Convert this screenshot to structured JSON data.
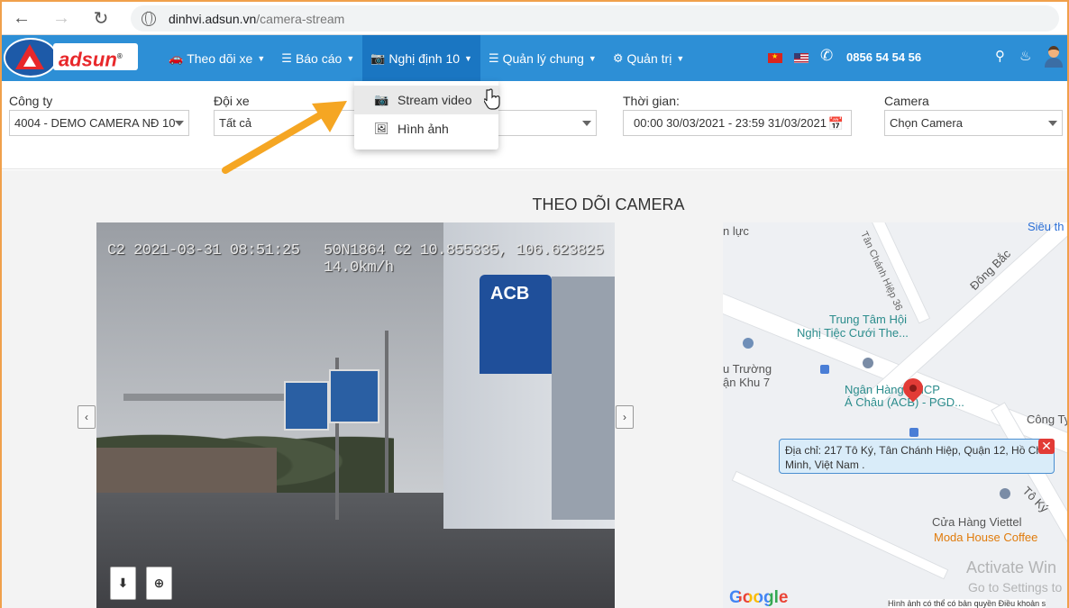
{
  "browser": {
    "url_host": "dinhvi.adsun.vn",
    "url_path": "/camera-stream"
  },
  "header": {
    "logo_text": "adsun",
    "menu": [
      {
        "label": "Theo dõi xe",
        "icon": "car-icon"
      },
      {
        "label": "Báo cáo",
        "icon": "list-icon"
      },
      {
        "label": "Nghị định 10",
        "icon": "camera-icon"
      },
      {
        "label": "Quản lý chung",
        "icon": "list-icon"
      },
      {
        "label": "Quản trị",
        "icon": "gears-icon"
      }
    ],
    "phone": "0856 54 54 56"
  },
  "dropdown": {
    "items": [
      {
        "label": "Stream video",
        "icon": "camera-icon"
      },
      {
        "label": "Hình ảnh",
        "icon": "image-icon"
      }
    ]
  },
  "filters": {
    "company_label": "Công ty",
    "company_value": "4004 - DEMO CAMERA NĐ 10",
    "fleet_label": "Đội xe",
    "fleet_value": "Tất cả",
    "time_label": "Thời gian:",
    "time_value": "00:00 30/03/2021 - 23:59 31/03/2021",
    "camera_label": "Camera",
    "camera_value": "Chọn Camera"
  },
  "main": {
    "title": "THEO DÕI CAMERA",
    "video_osd_left": "C2 2021-03-31 08:51:25",
    "video_osd_right": "50N1864 C2 10.855335, 106.623825 14.0km/h",
    "bank_sign": "ACB"
  },
  "map": {
    "labels": {
      "l1": "n lực",
      "l2": "Siêu th",
      "l3": "Tân Chánh Hiệp 36",
      "l4": "Đông Bắc",
      "l5": "Trung Tâm Hội",
      "l6": "Nghị Tiệc Cưới The...",
      "l7": "u Trường",
      "l8": "ận Khu 7",
      "l9": "Ngân Hàng TMCP",
      "l10": "Á Châu (ACB) - PGD...",
      "l11": "Công Ty",
      "l12": "Tô Ký",
      "l13": "Cửa Hàng Viettel",
      "l14": "Moda House Coffee"
    },
    "info_text": "Địa chỉ: 217 Tô Ký, Tân Chánh Hiệp, Quận 12, Hồ Chí Minh, Việt Nam .",
    "google": "Google",
    "attribution": "Hình ảnh có thể có bản quyền   Điều khoản s",
    "watermark": "Activate Win",
    "watermark2": "Go to Settings to"
  },
  "colors": {
    "header_bg": "#2d8fd6",
    "menu_active": "#1a76c2",
    "annotation_arrow": "#f5a623",
    "pin": "#e23b36"
  }
}
